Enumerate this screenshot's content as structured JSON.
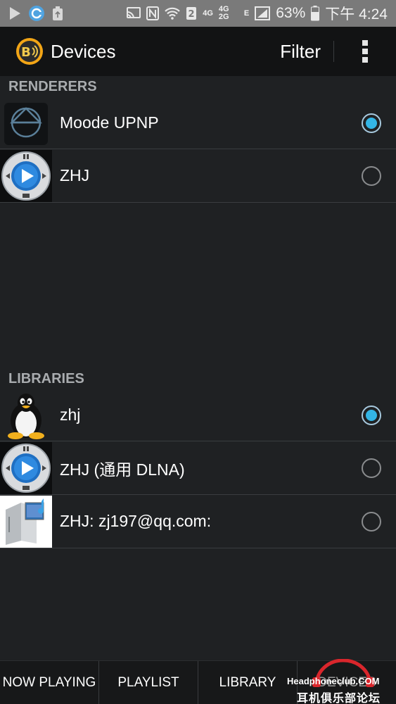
{
  "status_bar": {
    "left_icons": [
      "play-icon",
      "browser-icon",
      "recycle-icon"
    ],
    "right_icons": [
      "cast-icon",
      "nfc-icon",
      "wifi-icon",
      "sim-icon",
      "signal-icon",
      "battery-icon"
    ],
    "network_label_1": "4G",
    "network_label_2": "4G 2G",
    "network_label_3": "E",
    "sim_number": "2",
    "battery": "63%",
    "time": "下午 4:24"
  },
  "action_bar": {
    "title": "Devices",
    "filter_label": "Filter",
    "logo_text": "B"
  },
  "renderers": {
    "header": "RENDERERS",
    "items": [
      {
        "label": "Moode UPNP",
        "icon": "moode-icon",
        "selected": true
      },
      {
        "label": "ZHJ",
        "icon": "media-player-icon",
        "selected": false
      }
    ]
  },
  "libraries": {
    "header": "LIBRARIES",
    "items": [
      {
        "label": "zhj",
        "icon": "linux-penguin-icon",
        "selected": true
      },
      {
        "label": "ZHJ (通用 DLNA)",
        "icon": "media-player-icon",
        "selected": false
      },
      {
        "label": "ZHJ: zj197@qq.com:",
        "icon": "media-server-icon",
        "selected": false
      }
    ]
  },
  "tabs": {
    "now_playing": "NOW PLAYING",
    "playlist": "PLAYLIST",
    "library": "LIBRARY",
    "devices": "DEVICES"
  },
  "watermark": {
    "top": "Headphoneclub.COM",
    "bottom": "耳机俱乐部论坛"
  },
  "colors": {
    "accent": "#33b5e5",
    "background": "#1f2123",
    "action_bar": "#121314",
    "status_bar": "#7a7a7a"
  }
}
